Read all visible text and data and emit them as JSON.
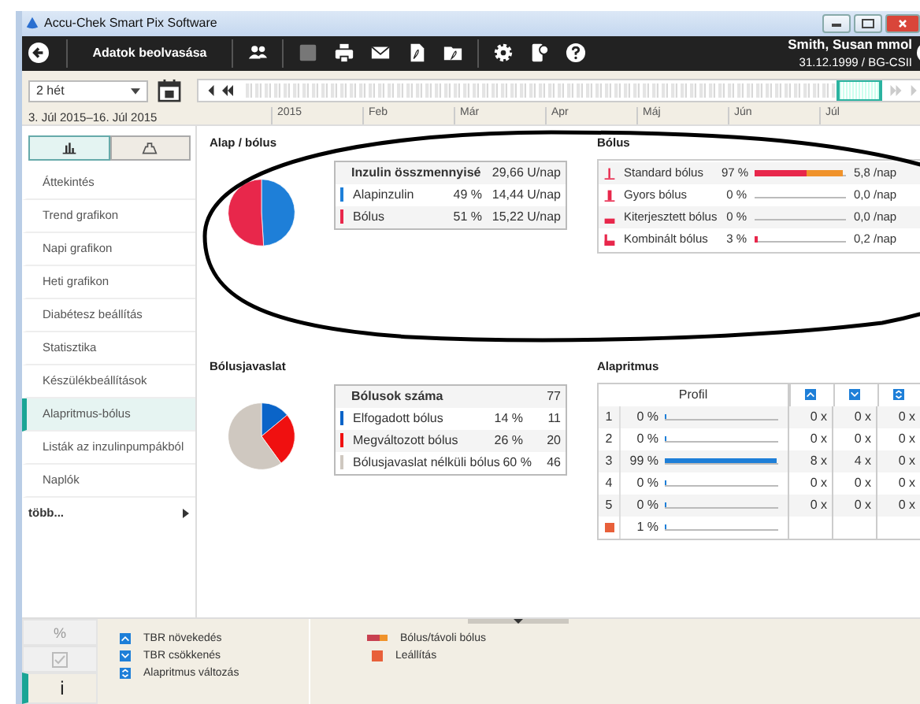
{
  "window": {
    "title": "Accu-Chek Smart Pix Software"
  },
  "toolbar": {
    "title": "Adatok beolvasása",
    "patient_name": "Smith, Susan mmol",
    "patient_info": "31.12.1999 / BG-CSII",
    "buttons": [
      {
        "kind": "people",
        "disabled": false
      },
      {
        "kind": "save",
        "disabled": true
      },
      {
        "kind": "print",
        "disabled": false
      },
      {
        "kind": "mail",
        "disabled": false
      },
      {
        "kind": "pdf",
        "disabled": false
      },
      {
        "kind": "pdf_folder",
        "disabled": false
      },
      {
        "kind": "settings",
        "disabled": false
      },
      {
        "kind": "device_settings",
        "disabled": false
      },
      {
        "kind": "help",
        "disabled": false
      }
    ]
  },
  "period": {
    "value": "2 hét",
    "date_range": "3. Júl 2015–16. Júl 2015"
  },
  "timeline": {
    "months": [
      "2015",
      "Feb",
      "Már",
      "Apr",
      "Máj",
      "Jún",
      "Júl"
    ]
  },
  "view_toggle": [
    {
      "kind": "bars",
      "selected": true
    },
    {
      "kind": "bag",
      "selected": false
    }
  ],
  "nav": [
    {
      "label": "Áttekintés",
      "selected": false
    },
    {
      "label": "Trend grafikon",
      "selected": false
    },
    {
      "label": "Napi grafikon",
      "selected": false
    },
    {
      "label": "Heti grafikon",
      "selected": false
    },
    {
      "label": "Diabétesz beállítás",
      "selected": false
    },
    {
      "label": "Statisztika",
      "selected": false
    },
    {
      "label": "Készülékbeállítások",
      "selected": false
    },
    {
      "label": "Alapritmus-bólus",
      "selected": true
    },
    {
      "label": "Listák az inzulinpumpákból",
      "selected": false
    },
    {
      "label": "Naplók",
      "selected": false
    }
  ],
  "more": "több...",
  "basal_bolus": {
    "title": "Alap / bólus",
    "chart_data": {
      "type": "pie",
      "values": [
        49,
        51
      ]
    },
    "header": {
      "label": "Inzulin összmennyisé",
      "value": "29,66 U/nap"
    },
    "rows": [
      {
        "label": "Alapinzulin",
        "color": "#1e7fd8",
        "percent": "49 %",
        "value": "14,44 U/nap"
      },
      {
        "label": "Bólus",
        "color": "#e8274b",
        "percent": "51 %",
        "value": "15,22 U/nap"
      }
    ]
  },
  "bolus_types": {
    "title": "Bólus",
    "rows": [
      {
        "kind": "standard",
        "label": "Standard bólus",
        "percent": "97 %",
        "segments": [
          {
            "color": "#e8274b",
            "level": 0.57
          },
          {
            "color": "#f0922a",
            "level": 0.4
          }
        ],
        "value": "5,8 /nap"
      },
      {
        "kind": "quick",
        "label": "Gyors bólus",
        "percent": "0 %",
        "segments": [],
        "value": "0,0 /nap"
      },
      {
        "kind": "extended",
        "label": "Kiterjesztett bólus",
        "percent": "0 %",
        "segments": [],
        "value": "0,0 /nap"
      },
      {
        "kind": "combined",
        "label": "Kombinált bólus",
        "percent": "3 %",
        "segments": [
          {
            "color": "#e8274b",
            "level": 0.03
          }
        ],
        "value": "0,2 /nap"
      }
    ]
  },
  "bolus_advice": {
    "title": "Bólusjavaslat",
    "chart_data": {
      "type": "pie",
      "values": [
        14,
        26,
        60
      ]
    },
    "header": {
      "label": "Bólusok száma",
      "value": "77"
    },
    "rows": [
      {
        "label": "Elfogadott bólus",
        "color": "#0a64c8",
        "percent": "14 %",
        "value": "11"
      },
      {
        "label": "Megváltozott bólus",
        "color": "#f01010",
        "percent": "26 %",
        "value": "20"
      },
      {
        "label": "Bólusjavaslat nélküli bólus",
        "color": "#cfc8c0",
        "percent": "60 %",
        "value": "46"
      }
    ]
  },
  "basal_rate": {
    "title": "Alapritmus",
    "header": {
      "label": "Profil",
      "columns": [
        {
          "kind": "tbr_up"
        },
        {
          "kind": "tbr_down"
        },
        {
          "kind": "basal_change"
        }
      ]
    },
    "rows": [
      {
        "kind": "profile",
        "label": "1",
        "percent": "0 %",
        "level": 0,
        "counts": [
          "0 x",
          "0 x",
          "0 x"
        ]
      },
      {
        "kind": "profile",
        "label": "2",
        "percent": "0 %",
        "level": 0,
        "counts": [
          "0 x",
          "0 x",
          "0 x"
        ]
      },
      {
        "kind": "profile",
        "label": "3",
        "percent": "99 %",
        "level": 0.99,
        "counts": [
          "8 x",
          "4 x",
          "0 x"
        ]
      },
      {
        "kind": "profile",
        "label": "4",
        "percent": "0 %",
        "level": 0,
        "counts": [
          "0 x",
          "0 x",
          "0 x"
        ]
      },
      {
        "kind": "profile",
        "label": "5",
        "percent": "0 %",
        "level": 0,
        "counts": [
          "0 x",
          "0 x",
          "0 x"
        ]
      },
      {
        "kind": "stop",
        "percent": "1 %",
        "level": 0.01
      }
    ]
  },
  "bottom_tabs": [
    {
      "kind": "percent",
      "label": "%",
      "selected": false
    },
    {
      "kind": "check",
      "selected": false
    },
    {
      "kind": "info",
      "label": "i",
      "selected": true
    }
  ],
  "legend": [
    [
      {
        "kind": "tbr_up",
        "label": "TBR növekedés"
      },
      {
        "kind": "tbr_down",
        "label": "TBR csökkenés"
      },
      {
        "kind": "basal_change",
        "label": "Alapritmus változás"
      }
    ],
    [
      {
        "kind": "bolus_bar",
        "label": "Bólus/távoli bólus"
      },
      {
        "kind": "stop",
        "label": "Leállítás"
      }
    ]
  ]
}
